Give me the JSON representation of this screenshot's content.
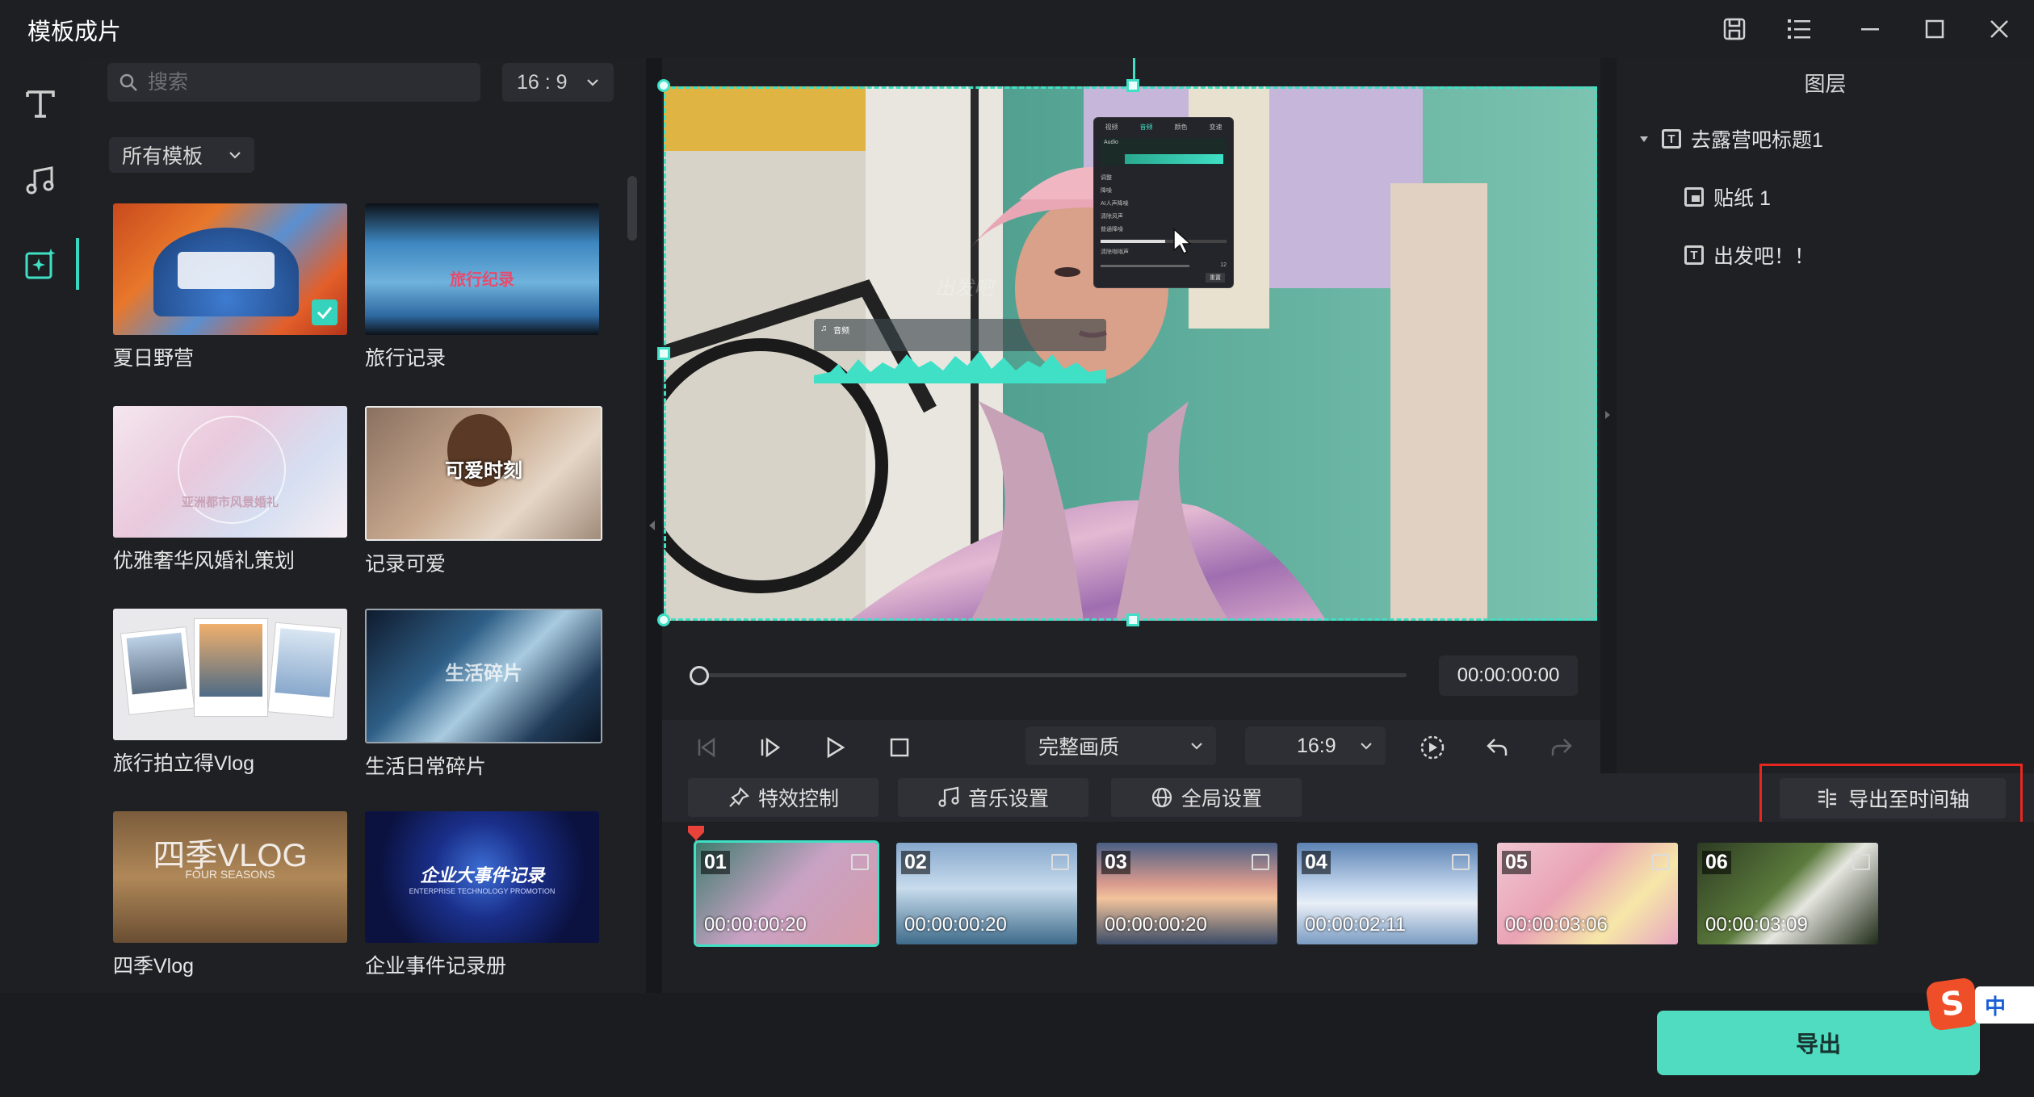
{
  "window": {
    "title": "模板成片"
  },
  "search": {
    "placeholder": "搜索",
    "value": ""
  },
  "ratio_filter": {
    "selected": "16 : 9"
  },
  "category_filter": {
    "selected": "所有模板"
  },
  "templates": [
    {
      "name": "夏日野营",
      "selected": true
    },
    {
      "name": "旅行记录",
      "thumb_text": "旅行纪录"
    },
    {
      "name": "优雅奢华风婚礼策划",
      "thumb_text": "亚洲都市风景婚礼"
    },
    {
      "name": "记录可爱",
      "thumb_text": "可爱时刻"
    },
    {
      "name": "旅行拍立得Vlog"
    },
    {
      "name": "生活日常碎片",
      "thumb_text": "生活碎片"
    },
    {
      "name": "四季Vlog",
      "thumb_text": "四季VLOG",
      "thumb_sub": "FOUR SEASONS"
    },
    {
      "name": "企业事件记录册",
      "thumb_text": "企业大事件记录",
      "thumb_sub": "ENTERPRISE TECHNOLOGY PROMOTION"
    }
  ],
  "preview": {
    "overlay_text": "出发吧",
    "audio_tag": "音频",
    "mini_panel": {
      "tabs": [
        "视频",
        "音频",
        "颜色",
        "变速"
      ],
      "audio_label": "Audio",
      "rows": [
        "调整",
        "降噪",
        "AI人声降噪",
        "清除风声",
        "普通降噪",
        "清除嗡嗡声"
      ],
      "reset_label": "重置",
      "value_label": "12"
    },
    "time": "00:00:00:00",
    "progress": 0,
    "quality": "完整画质",
    "aspect": "16:9"
  },
  "layers": {
    "title": "图层",
    "items": [
      {
        "type": "text",
        "label": "去露营吧标题1",
        "expanded": true
      },
      {
        "type": "sticker",
        "label": "贴纸 1"
      },
      {
        "type": "text",
        "label": "出发吧！！"
      }
    ]
  },
  "toolbar": {
    "effects": "特效控制",
    "music": "音乐设置",
    "global": "全局设置",
    "export_timeline": "导出至时间轴"
  },
  "clips": [
    {
      "num": "01",
      "duration": "00:00:00:20",
      "selected": true
    },
    {
      "num": "02",
      "duration": "00:00:00:20"
    },
    {
      "num": "03",
      "duration": "00:00:00:20"
    },
    {
      "num": "04",
      "duration": "00:00:02:11"
    },
    {
      "num": "05",
      "duration": "00:00:03:06"
    },
    {
      "num": "06",
      "duration": "00:00:03:09"
    }
  ],
  "footer": {
    "export": "导出",
    "ime_label": "中"
  },
  "colors": {
    "accent": "#3fe0c6",
    "export_btn": "#4fdcc0",
    "highlight": "#e8281f",
    "bg": "#1b1c20"
  }
}
